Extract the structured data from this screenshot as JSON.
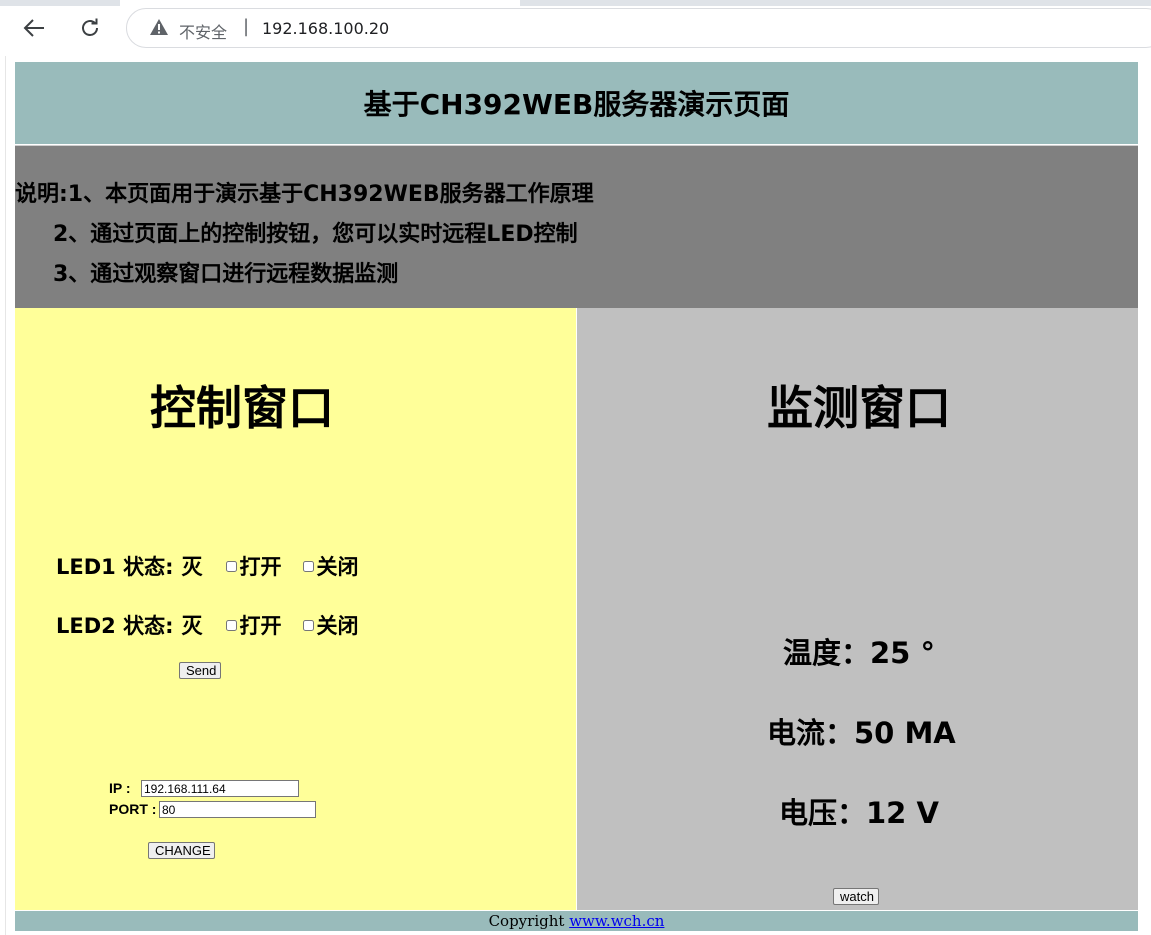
{
  "browser": {
    "security_text": "不安全",
    "separator": "|",
    "url": "192.168.100.20"
  },
  "header": {
    "title": "基于CH392WEB服务器演示页面"
  },
  "description": {
    "line1": "说明:1、本页面用于演示基于CH392WEB服务器工作原理",
    "line2": "2、通过页面上的控制按钮，您可以实时远程LED控制",
    "line3": "3、通过观察窗口进行远程数据监测"
  },
  "control": {
    "title": "控制窗口",
    "leds": [
      {
        "label": "LED1 状态:",
        "state": "灭",
        "on_label": "打开",
        "off_label": "关闭"
      },
      {
        "label": "LED2 状态:",
        "state": "灭",
        "on_label": "打开",
        "off_label": "关闭"
      }
    ],
    "send_label": "Send",
    "ip_label": "IP :",
    "ip_value": "192.168.111.64",
    "port_label": "PORT :",
    "port_value": "80",
    "change_label": "CHANGE"
  },
  "monitor": {
    "title": "监测窗口",
    "temperature": "温度：25 °",
    "current": "电流：50 MA",
    "voltage": "电压：12 V",
    "watch_label": "watch"
  },
  "footer": {
    "copyright": "Copyright ",
    "link_text": "www.wch.cn"
  },
  "colors": {
    "header_bg": "#99bbbb",
    "description_bg": "#808080",
    "control_bg": "#ffff99",
    "monitor_bg": "#c0c0c0"
  },
  "icons": [
    "back-arrow-icon",
    "reload-icon",
    "warning-icon"
  ]
}
